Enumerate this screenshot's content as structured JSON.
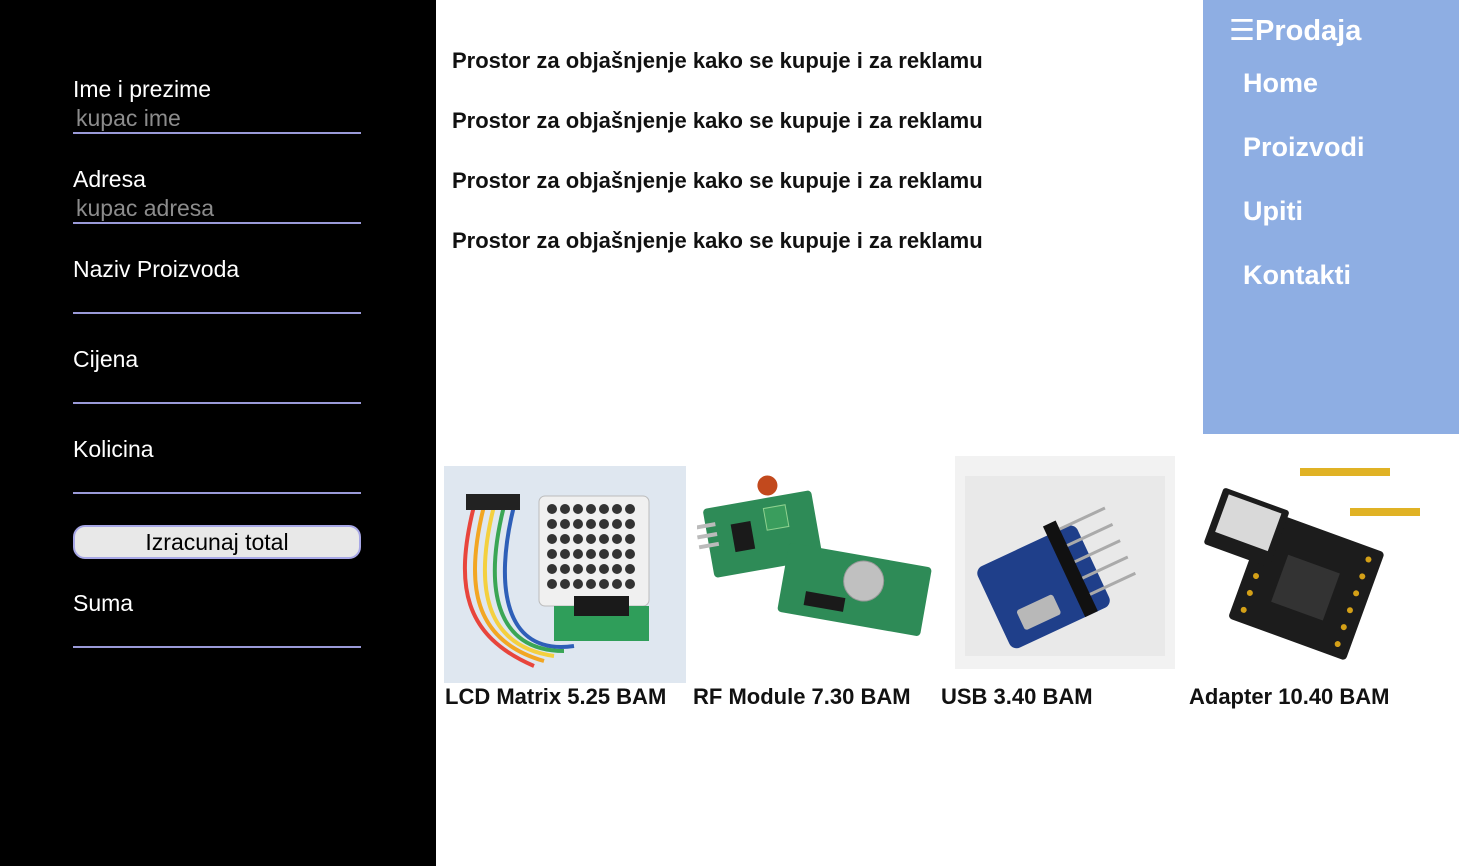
{
  "form": {
    "name_label": "Ime i prezime",
    "name_placeholder": "kupac ime",
    "address_label": "Adresa",
    "address_placeholder": "kupac adresa",
    "product_label": "Naziv Proizvoda",
    "price_label": "Cijena",
    "quantity_label": "Kolicina",
    "calc_button": "Izracunaj total",
    "sum_label": "Suma"
  },
  "promo": {
    "lines": [
      "Prostor za objašnjenje kako se kupuje i za reklamu",
      "Prostor za objašnjenje kako se kupuje i za reklamu",
      "Prostor za objašnjenje kako se kupuje i za reklamu",
      "Prostor za objašnjenje kako se kupuje i za reklamu"
    ]
  },
  "nav": {
    "menu_icon": "☰",
    "title": "Prodaja",
    "items": [
      "Home",
      "Proizvodi",
      "Upiti",
      "Kontakti"
    ]
  },
  "products": [
    {
      "caption": "LCD Matrix 5.25 BAM",
      "icon": "led-matrix-module-image"
    },
    {
      "caption": "RF Module 7.30 BAM",
      "icon": "rf-module-image"
    },
    {
      "caption": "USB 3.40 BAM",
      "icon": "usb-breakout-image"
    },
    {
      "caption": "Adapter 10.40 BAM",
      "icon": "esp-adapter-board-image"
    }
  ],
  "colors": {
    "form_bg": "#000000",
    "nav_bg": "#8eaee3",
    "input_underline": "#9a9ad8"
  }
}
